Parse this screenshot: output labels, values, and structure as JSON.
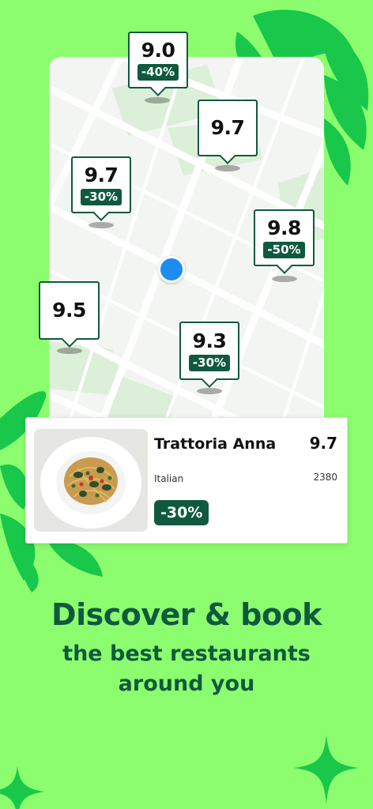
{
  "colors": {
    "background": "#8CFD6E",
    "brand_dark_green": "#0F5A3F",
    "leaf_green": "#19C84A",
    "user_location_blue": "#1C8CF0"
  },
  "map": {
    "pins": [
      {
        "score": "9.0",
        "discount": "-40%"
      },
      {
        "score": "9.7",
        "discount": ""
      },
      {
        "score": "9.7",
        "discount": "-30%"
      },
      {
        "score": "9.8",
        "discount": "-50%"
      },
      {
        "score": "9.5",
        "discount": ""
      },
      {
        "score": "9.3",
        "discount": "-30%"
      }
    ]
  },
  "restaurant_card": {
    "name": "Trattoria Anna",
    "score": "9.7",
    "cuisine": "Italian",
    "review_count": "2380",
    "discount": "-30%",
    "photo_icon": "pasta-dish-image"
  },
  "headline": {
    "line1": "Discover & book",
    "line2": "the best restaurants",
    "line3": "around you"
  }
}
